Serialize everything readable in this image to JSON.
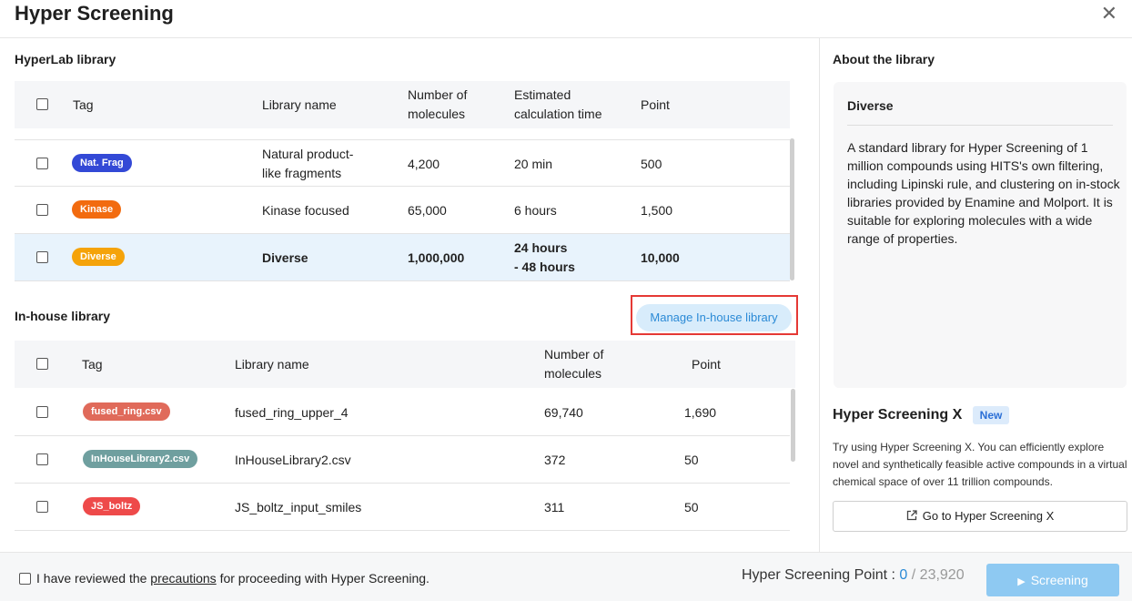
{
  "dialog": {
    "title": "Hyper Screening"
  },
  "hyperlab": {
    "section_title": "HyperLab library",
    "headers": {
      "tag": "Tag",
      "library_name": "Library name",
      "molecules_1": "Number of",
      "molecules_2": "molecules",
      "time_1": "Estimated",
      "time_2": "calculation time",
      "point": "Point"
    },
    "rows": [
      {
        "tag": "Nat. Frag",
        "tag_color": "#3349d6",
        "name_1": "Natural product-",
        "name_2": "like fragments",
        "molecules": "4,200",
        "time_1": "20 min",
        "time_2": "",
        "point": "500",
        "selected": false
      },
      {
        "tag": "Kinase",
        "tag_color": "#f26b0f",
        "name_1": "Kinase focused",
        "name_2": "",
        "molecules": "65,000",
        "time_1": "6 hours",
        "time_2": "",
        "point": "1,500",
        "selected": false
      },
      {
        "tag": "Diverse",
        "tag_color": "#f5a30a",
        "name_1": "Diverse",
        "name_2": "",
        "molecules": "1,000,000",
        "time_1": "24 hours",
        "time_2": "- 48 hours",
        "point": "10,000",
        "selected": true
      }
    ]
  },
  "inhouse": {
    "section_title": "In-house library",
    "manage_button": "Manage In-house library",
    "headers": {
      "tag": "Tag",
      "library_name": "Library name",
      "molecules_1": "Number of",
      "molecules_2": "molecules",
      "point": "Point"
    },
    "rows": [
      {
        "tag": "fused_ring.csv",
        "tag_color": "#e06a5a",
        "name": "fused_ring_upper_4",
        "molecules": "69,740",
        "point": "1,690"
      },
      {
        "tag": "InHouseLibrary2.csv",
        "tag_color": "#6f9f9f",
        "name": "InHouseLibrary2.csv",
        "molecules": "372",
        "point": "50"
      },
      {
        "tag": "JS_boltz",
        "tag_color": "#ee4a4a",
        "name": "JS_boltz_input_smiles",
        "molecules": "311",
        "point": "50"
      }
    ]
  },
  "about": {
    "section_title": "About the library",
    "name": "Diverse",
    "description": "A standard library for Hyper Screening of 1 million compounds using HITS's own filtering, including Lipinski rule, and clustering on in-stock libraries provided by Enamine and Molport. It is suitable for exploring molecules with a wide range of properties."
  },
  "hsx": {
    "title": "Hyper Screening X",
    "badge": "New",
    "description": "Try using Hyper Screening X. You can efficiently explore novel and synthetically feasible active compounds in a virtual chemical space of over 11 trillion compounds.",
    "button": "Go to Hyper Screening X"
  },
  "footer": {
    "agree_prefix": "I have reviewed the ",
    "agree_link": "precautions",
    "agree_suffix": " for proceeding with Hyper Screening.",
    "points_label": "Hyper Screening Point : ",
    "points_current": "0",
    "points_total": " / 23,920",
    "screening_button": "Screening"
  }
}
